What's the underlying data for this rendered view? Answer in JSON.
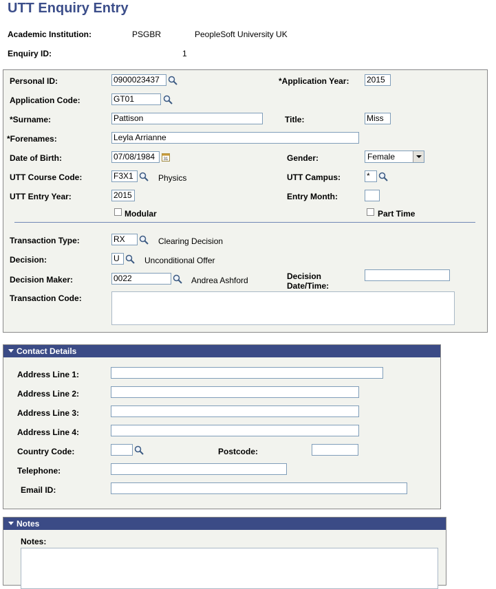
{
  "page": {
    "title": "UTT Enquiry Entry",
    "institution_label": "Academic Institution:",
    "institution_code": "PSGBR",
    "institution_name": "PeopleSoft University UK",
    "enquiry_label": "Enquiry ID:",
    "enquiry_id": "1"
  },
  "main": {
    "personal_id_label": "Personal ID:",
    "personal_id": "0900023437",
    "app_year_label": "*Application Year:",
    "app_year": "2015",
    "app_code_label": "Application Code:",
    "app_code": "GT01",
    "surname_label": "*Surname:",
    "surname": "Pattison",
    "title_label": "Title:",
    "title": "Miss",
    "forenames_label": "*Forenames:",
    "forenames": "Leyla Arrianne",
    "dob_label": "Date of Birth:",
    "dob": "07/08/1984",
    "gender_label": "Gender:",
    "gender": "Female",
    "course_label": "UTT Course Code:",
    "course_code": "F3X1",
    "course_desc": "Physics",
    "campus_label": "UTT Campus:",
    "campus": "*",
    "entry_year_label": "UTT Entry Year:",
    "entry_year": "2015",
    "entry_month_label": "Entry Month:",
    "entry_month": "",
    "modular_label": "Modular",
    "part_time_label": "Part Time",
    "trans_type_label": "Transaction Type:",
    "trans_type": "RX",
    "trans_type_desc": "Clearing Decision",
    "decision_label": "Decision:",
    "decision": "U",
    "decision_desc": "Unconditional Offer",
    "decision_maker_label": "Decision Maker:",
    "decision_maker": "0022",
    "decision_maker_name": "Andrea Ashford",
    "decision_dt_label1": "Decision",
    "decision_dt_label2": "Date/Time:",
    "decision_dt": "",
    "trans_code_label": "Transaction Code:",
    "trans_code": ""
  },
  "contact": {
    "header": "Contact Details",
    "addr1_label": "Address Line 1:",
    "addr2_label": "Address Line 2:",
    "addr3_label": "Address Line 3:",
    "addr4_label": "Address Line 4:",
    "country_label": "Country Code:",
    "postcode_label": "Postcode:",
    "telephone_label": "Telephone:",
    "email_label": "Email ID:",
    "addr1": "",
    "addr2": "",
    "addr3": "",
    "addr4": "",
    "country": "",
    "postcode": "",
    "telephone": "",
    "email": ""
  },
  "notes": {
    "header": "Notes",
    "notes_label": "Notes:",
    "notes": ""
  },
  "icons": {
    "lookup": "magnifier-icon",
    "calendar": "calendar-icon",
    "collapse": "collapse-triangle-icon"
  },
  "colors": {
    "title": "#3c4e8a",
    "section_header": "#3b4b86",
    "panel_bg": "#f2f3ee"
  }
}
